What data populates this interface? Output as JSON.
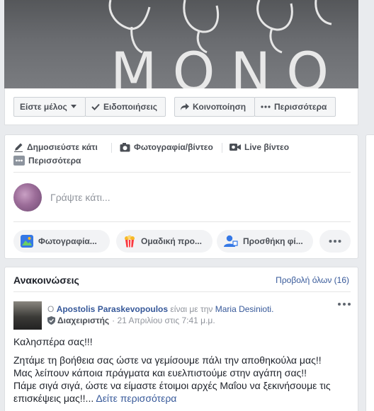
{
  "cover": {
    "text": "MONO"
  },
  "actionbar": {
    "member_label": "Είστε μέλος",
    "notifications_label": "Ειδοποιήσεις",
    "share_label": "Κοινοποίηση",
    "more_label": "Περισσότερα"
  },
  "composer": {
    "tabs": {
      "post": "Δημοσιεύστε κάτι",
      "photo": "Φωτογραφία/βίντεο",
      "live": "Live βίντεο",
      "more": "Περισσότερα"
    },
    "placeholder": "Γράψτε κάτι...",
    "pills": {
      "photo": "Φωτογραφία...",
      "group": "Ομαδική προ...",
      "tag": "Προσθήκη φί..."
    }
  },
  "announcements": {
    "title": "Ανακοινώσεις",
    "view_all": "Προβολή όλων (16)",
    "post": {
      "prefix": "Ο",
      "author": "Apostolis Paraskevopoulos",
      "connector": "είναι με την",
      "with": "Maria Desinioti.",
      "role": "Διαχειριστής",
      "date": "· 21 Απριλίου στις 7:41 μ.μ.",
      "lines": [
        "Καλησπέρα σας!!!",
        "",
        "Ζητάμε τη βοήθεια σας ώστε να γεμίσουμε πάλι την αποθηκούλα μας!!",
        "Μας λείπουν κάποια πράγματα και ευελπιστούμε στην αγάπη σας!!",
        "Πάμε σιγά σιγά, ώστε να είμαστε έτοιμοι αρχές Μαΐου να ξεκινήσουμε τις"
      ],
      "last_line": "επισκέψεις μας!!...",
      "see_more": "Δείτε περισσότερα"
    }
  },
  "colors": {
    "link": "#365899",
    "muted": "#90949c",
    "page_bg": "#e9ebee"
  }
}
